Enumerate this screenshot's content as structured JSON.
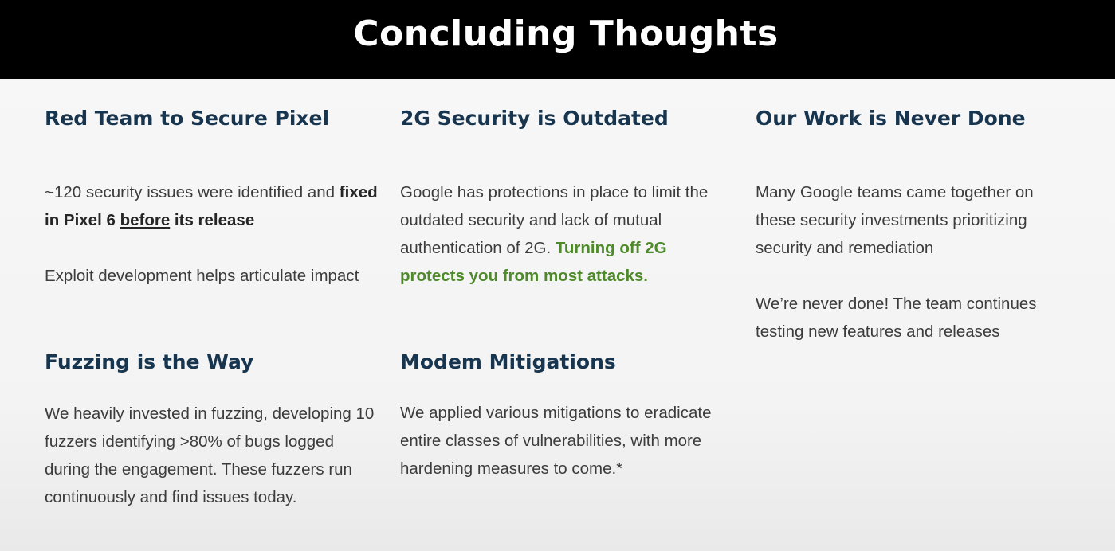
{
  "title": "Concluding Thoughts",
  "sections": {
    "red_team": {
      "heading": "Red Team to Secure Pixel",
      "p1_plain": "~120 security issues were identified and",
      "p1_bold_a": "fixed in Pixel 6 ",
      "p1_bold_underline": "before",
      "p1_bold_b": " its release",
      "p2": "Exploit development helps articulate impact"
    },
    "g2": {
      "heading": "2G Security is Outdated",
      "p1_plain": "Google has protections in place to limit the outdated security and lack of mutual authentication of 2G. ",
      "p1_green": "Turning off 2G protects you from most attacks."
    },
    "never_done": {
      "heading": "Our Work is Never Done",
      "p1": "Many Google teams came together on these security investments prioritizing security and remediation",
      "p2": "We’re never done! The team continues testing new features and releases"
    },
    "fuzzing": {
      "heading": "Fuzzing is the Way",
      "p1": "We heavily invested in fuzzing, developing 10 fuzzers identifying >80% of bugs logged during the engagement. These fuzzers run continuously and find issues today."
    },
    "modem": {
      "heading": "Modem Mitigations",
      "p1": "We applied various mitigations to eradicate entire classes of vulnerabilities, with more hardening measures to come.*"
    }
  },
  "colors": {
    "title_bar": "#000000",
    "heading": "#17354f",
    "body_text": "#3c3c3c",
    "highlight_green": "#4e8a2a"
  }
}
